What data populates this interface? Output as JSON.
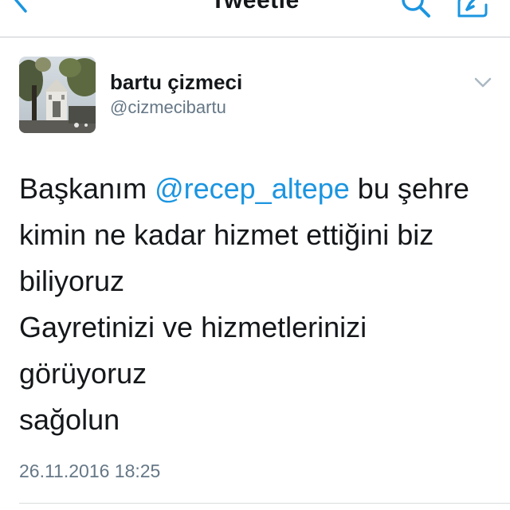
{
  "nav": {
    "title": "Tweetle",
    "back_icon": "chevron-left-icon",
    "search_icon": "search-icon",
    "compose_icon": "compose-icon",
    "accent": "#1b95e0"
  },
  "tweet": {
    "author": {
      "display_name": "bartu çizmeci",
      "handle": "@cizmecibartu"
    },
    "text": {
      "line1_before": "Başkanım ",
      "line1_mention": "@recep_altepe",
      "line1_after": " bu şehre",
      "line2": "kimin ne kadar hizmet ettiğini biz",
      "line3": "biliyoruz",
      "line4": "Gayretinizi ve hizmetlerinizi",
      "line5": "görüyoruz",
      "line6": "sağolun"
    },
    "timestamp": "26.11.2016 18:25",
    "caret_icon": "chevron-down-icon"
  },
  "colors": {
    "text_primary": "#14171a",
    "text_secondary": "#657786",
    "link": "#1b95e0",
    "divider": "#d8dbde"
  }
}
